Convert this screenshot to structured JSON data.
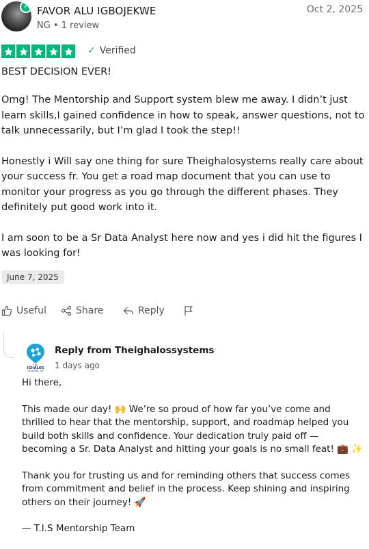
{
  "reviewer": {
    "name": "FAVOR ALU IGBOJEKWE",
    "meta": "NG • 1 review",
    "date": "Oct 2, 2025"
  },
  "rating": {
    "stars": 5,
    "max": 5,
    "verified_label": "Verified"
  },
  "review": {
    "title": "BEST DECISION EVER!",
    "paragraphs": [
      "Omg! The Mentorship and Support system blew me away. I didn’t just learn skills,I gained confidence in how to speak, answer questions, not to talk unnecessarily, but I’m glad I took the step!!",
      "Honestly i Will say one thing for sure Theighalosystems really care about your success fr. You get a road map document that you can use to monitor your progress as you go through the different phases. They definitely put good work into it.",
      "I am soon to be a Sr Data Analyst here now and yes i did hit the figures I was looking for!"
    ],
    "experience_date": "June 7, 2025"
  },
  "actions": {
    "useful": "Useful",
    "share": "Share",
    "reply": "Reply"
  },
  "reply": {
    "from": "Reply from Theighalossystems",
    "ago": "1 days ago",
    "paragraphs": [
      "Hi there,",
      "This made our day! 🙌 We’re so proud of how far you’ve come and thrilled to hear that the mentorship, support, and roadmap helped you build both skills and confidence. Your dedication truly paid off — becoming a Sr. Data Analyst and hitting your goals is no small feat! 💼 ✨",
      "Thank you for trusting us and for reminding others that success comes from commitment and belief in the process. Keep shining and inspiring others on their journey! 🚀",
      "— T.I.S Mentorship Team"
    ],
    "logo_text": [
      "THE",
      "IGHALOS",
      "SYSTEMS, Inc"
    ]
  },
  "colors": {
    "star_green": "#00b67a",
    "logo_blue": "#1aa3d9"
  }
}
